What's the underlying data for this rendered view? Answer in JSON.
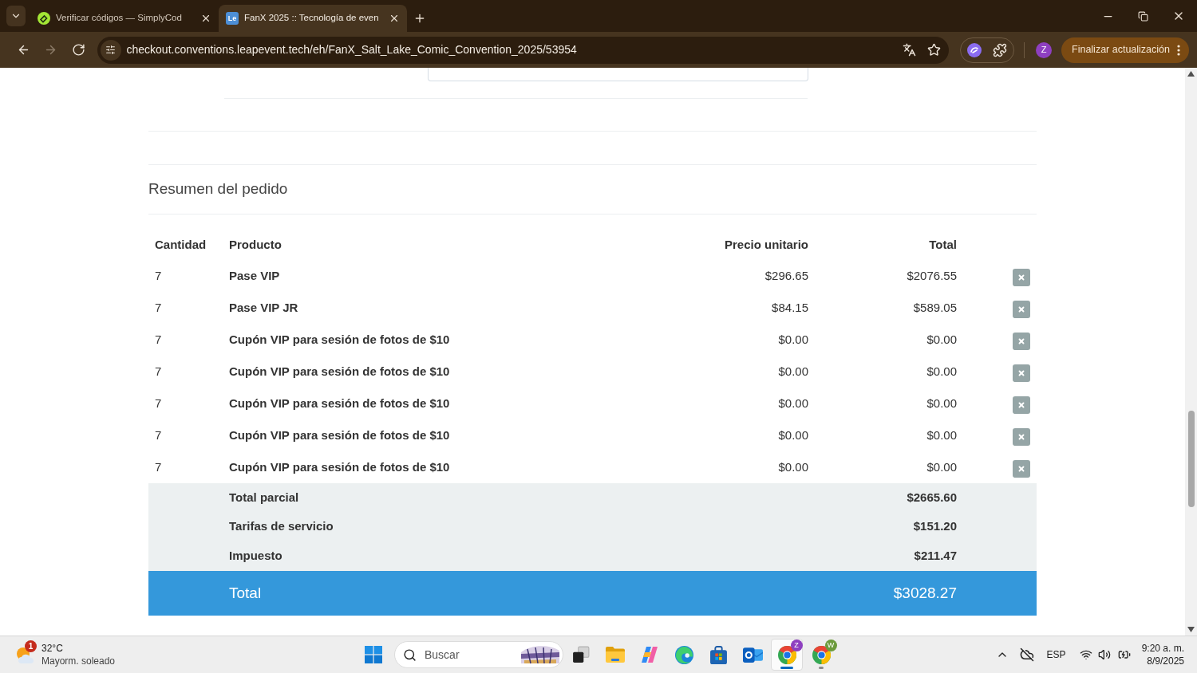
{
  "browser": {
    "tabs": [
      {
        "title": "Verificar códigos — SimplyCod",
        "selected": false
      },
      {
        "title": "FanX 2025 :: Tecnología de even",
        "favicon_text": "Le",
        "selected": true
      }
    ],
    "nav": [
      {
        "kind": "back",
        "disabled": false
      },
      {
        "kind": "forward",
        "disabled": true
      },
      {
        "kind": "reload",
        "disabled": false
      }
    ],
    "url": "checkout.conventions.leapevent.tech/eh/FanX_Salt_Lake_Comic_Convention_2025/53954",
    "profile": "Z",
    "update_button": "Finalizar actualización"
  },
  "order_summary": {
    "title": "Resumen del pedido",
    "columns": [
      "Cantidad",
      "Producto",
      "Precio unitario",
      "Total"
    ],
    "rows": [
      {
        "quantity": "7",
        "product": "Pase VIP",
        "unit_price": "$296.65",
        "total": "$2076.55"
      },
      {
        "quantity": "7",
        "product": "Pase VIP JR",
        "unit_price": "$84.15",
        "total": "$589.05"
      },
      {
        "quantity": "7",
        "product": "Cupón VIP para sesión de fotos de $10",
        "unit_price": "$0.00",
        "total": "$0.00"
      },
      {
        "quantity": "7",
        "product": "Cupón VIP para sesión de fotos de $10",
        "unit_price": "$0.00",
        "total": "$0.00"
      },
      {
        "quantity": "7",
        "product": "Cupón VIP para sesión de fotos de $10",
        "unit_price": "$0.00",
        "total": "$0.00"
      },
      {
        "quantity": "7",
        "product": "Cupón VIP para sesión de fotos de $10",
        "unit_price": "$0.00",
        "total": "$0.00"
      },
      {
        "quantity": "7",
        "product": "Cupón VIP para sesión de fotos de $10",
        "unit_price": "$0.00",
        "total": "$0.00"
      }
    ],
    "totals": [
      {
        "label": "Total parcial",
        "value": "$2665.60"
      },
      {
        "label": "Tarifas de servicio",
        "value": "$151.20"
      },
      {
        "label": "Impuesto",
        "value": "$211.47"
      }
    ],
    "grand_total": {
      "label": "Total",
      "value": "$3028.27"
    }
  },
  "taskbar": {
    "weather": {
      "badge": "1",
      "temperature": "32°C",
      "condition": "Mayorm. soleado"
    },
    "search": {
      "placeholder": "Buscar"
    },
    "apps": [
      {
        "kind": "taskview",
        "running": false,
        "selected": false
      },
      {
        "kind": "files",
        "running": false,
        "selected": false
      },
      {
        "kind": "copilot",
        "running": false,
        "selected": false
      },
      {
        "kind": "edge",
        "running": false,
        "selected": false
      },
      {
        "kind": "store",
        "running": false,
        "selected": false
      },
      {
        "kind": "outlook",
        "running": false,
        "selected": false
      },
      {
        "kind": "chrome",
        "badge": "Z",
        "color": "#8e3fc0",
        "running": true,
        "selected": true
      },
      {
        "kind": "chrome",
        "badge": "W",
        "color": "#6c9b3c",
        "running": true,
        "selected": false
      }
    ],
    "tray": {
      "language": "ESP",
      "time": "9:20 a. m.",
      "date": "8/9/2025"
    }
  }
}
